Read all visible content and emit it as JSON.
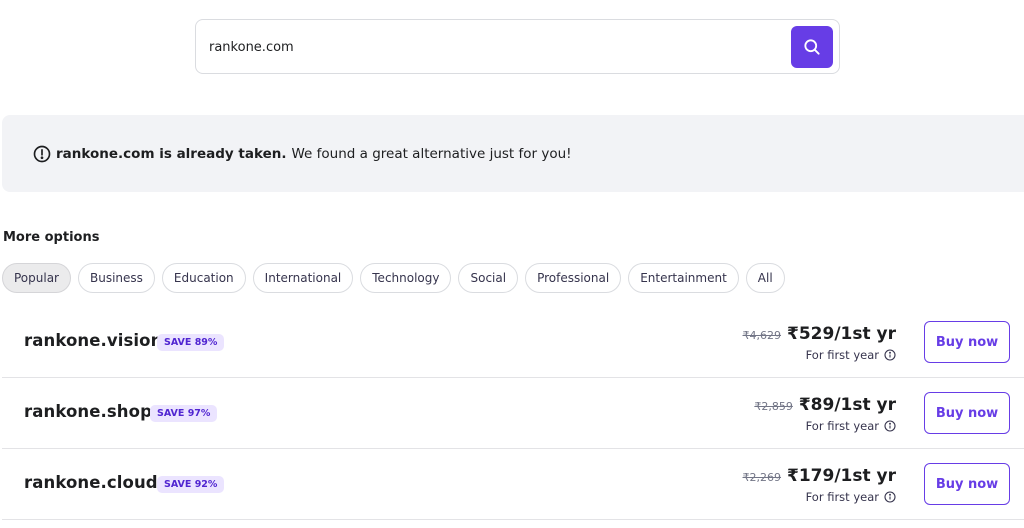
{
  "search": {
    "value": "rankone.com",
    "button_icon": "search-icon"
  },
  "alert": {
    "icon": "exclamation-circle-icon",
    "strong": "rankone.com is already taken.",
    "rest": "We found a great alternative just for you!"
  },
  "more_options": {
    "title": "More options",
    "chips": [
      {
        "label": "Popular",
        "active": true
      },
      {
        "label": "Business",
        "active": false
      },
      {
        "label": "Education",
        "active": false
      },
      {
        "label": "International",
        "active": false
      },
      {
        "label": "Technology",
        "active": false
      },
      {
        "label": "Social",
        "active": false
      },
      {
        "label": "Professional",
        "active": false
      },
      {
        "label": "Entertainment",
        "active": false
      },
      {
        "label": "All",
        "active": false
      }
    ]
  },
  "results": [
    {
      "domain": "rankone.vision",
      "badge": "SAVE 89%",
      "old_price": "₹4,629",
      "new_price": "₹529/1st yr",
      "note": "For first year",
      "buy_label": "Buy now"
    },
    {
      "domain": "rankone.shop",
      "badge": "SAVE 97%",
      "old_price": "₹2,859",
      "new_price": "₹89/1st yr",
      "note": "For first year",
      "buy_label": "Buy now"
    },
    {
      "domain": "rankone.cloud",
      "badge": "SAVE 92%",
      "old_price": "₹2,269",
      "new_price": "₹179/1st yr",
      "note": "For first year",
      "buy_label": "Buy now"
    }
  ],
  "colors": {
    "accent": "#673de6",
    "badge_bg": "#ebe4ff",
    "alert_bg": "#f2f3f6"
  }
}
